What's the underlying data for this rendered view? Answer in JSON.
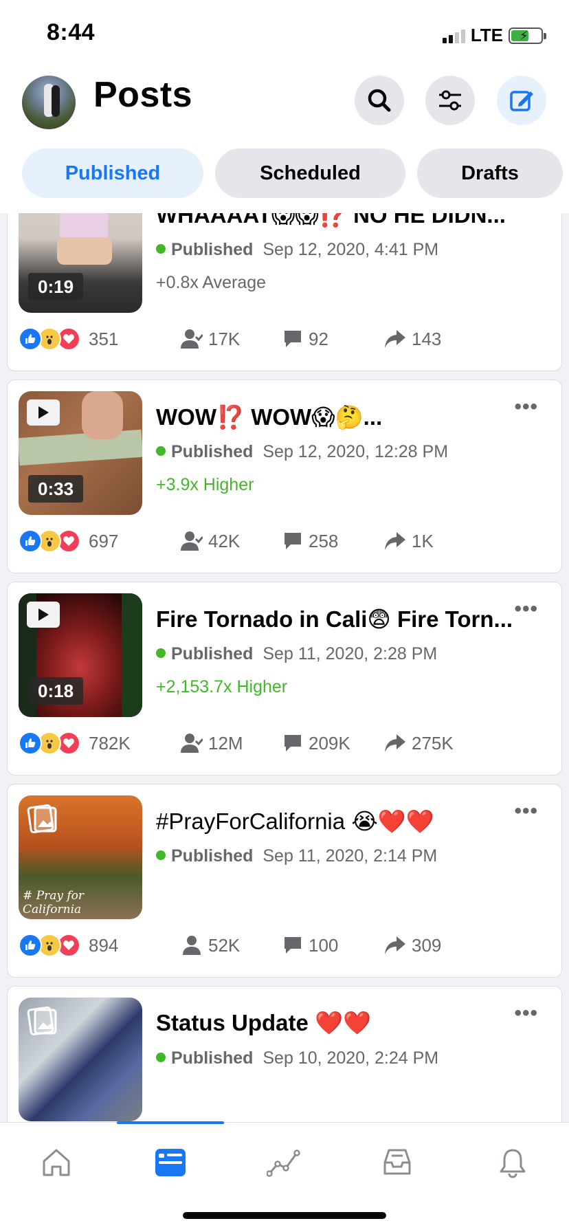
{
  "status_bar": {
    "time": "8:44",
    "network": "LTE"
  },
  "header": {
    "title": "Posts"
  },
  "tabs": [
    {
      "label": "Published",
      "active": true
    },
    {
      "label": "Scheduled",
      "active": false
    },
    {
      "label": "Drafts",
      "active": false
    }
  ],
  "posts": [
    {
      "title": "WHAAAAT😱😱⁉️ NO HE DIDN...",
      "status": "Published",
      "date": "Sep 12, 2020, 4:41 PM",
      "performance": "+0.8x Average",
      "duration": "0:19",
      "reactions": "351",
      "reach": "17K",
      "comments": "92",
      "shares": "143"
    },
    {
      "title": "WOW⁉️ WOW😱🤔...",
      "status": "Published",
      "date": "Sep 12, 2020, 12:28 PM",
      "performance": "+3.9x Higher",
      "duration": "0:33",
      "reactions": "697",
      "reach": "42K",
      "comments": "258",
      "shares": "1K"
    },
    {
      "title": "Fire Tornado in Cali😨 Fire Torn...",
      "status": "Published",
      "date": "Sep 11, 2020, 2:28 PM",
      "performance": "+2,153.7x Higher",
      "duration": "0:18",
      "reactions": "782K",
      "reach": "12M",
      "comments": "209K",
      "shares": "275K"
    },
    {
      "title": "#PrayForCalifornia 😭❤️❤️",
      "status": "Published",
      "date": "Sep 11, 2020, 2:14 PM",
      "thumb_caption": "# Pray for California",
      "reactions": "894",
      "reach": "52K",
      "comments": "100",
      "shares": "309"
    },
    {
      "title": "Status Update ❤️❤️",
      "status": "Published",
      "date": "Sep 10, 2020, 2:24 PM"
    }
  ],
  "more_label": "•••",
  "colors": {
    "accent": "#1877f2",
    "positive": "#42b72a",
    "muted": "#65676b"
  },
  "bottom_nav": [
    "home-icon",
    "posts-icon",
    "insights-icon",
    "inbox-icon",
    "notifications-icon"
  ]
}
